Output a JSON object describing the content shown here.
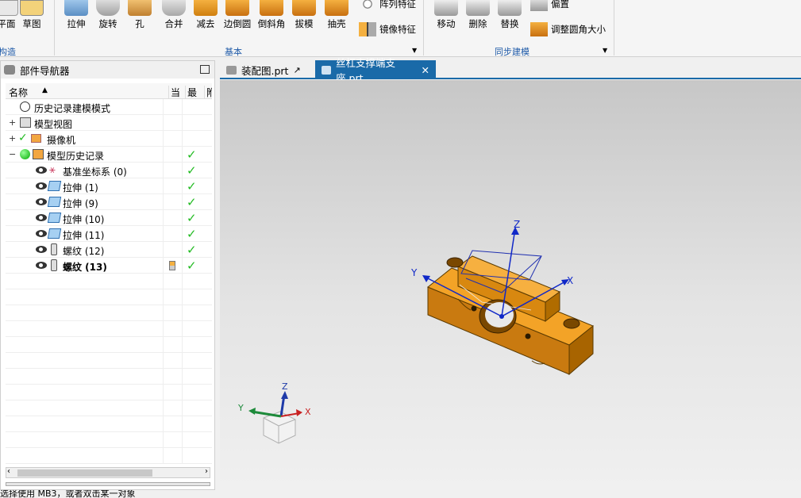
{
  "ribbon": {
    "left_group": {
      "buttons": [
        "平面",
        "草图"
      ],
      "label": "构造"
    },
    "basic_group": {
      "buttons": [
        "拉伸",
        "旋转",
        "孔",
        "合并",
        "减去",
        "边倒圆",
        "倒斜角",
        "拔模",
        "抽壳"
      ],
      "small_buttons": [
        "阵列特征",
        "镜像特征"
      ],
      "label": "基本"
    },
    "sync_group": {
      "buttons": [
        "移动",
        "删除",
        "替换"
      ],
      "small_buttons": [
        "偏置",
        "调整圆角大小"
      ],
      "label": "同步建模"
    }
  },
  "navigator": {
    "title": "部件导航器",
    "columns": {
      "name": "名称",
      "current": "当",
      "latest": "最",
      "attach": "附"
    },
    "rows": [
      {
        "label": "历史记录建模模式",
        "kind": "clock"
      },
      {
        "label": "模型视图",
        "kind": "view"
      },
      {
        "label": "摄像机",
        "kind": "camera"
      },
      {
        "label": "模型历史记录",
        "kind": "history"
      },
      {
        "label": "基准坐标系 (0)",
        "kind": "datum"
      },
      {
        "label": "拉伸 (1)",
        "kind": "extrude"
      },
      {
        "label": "拉伸 (9)",
        "kind": "extrude"
      },
      {
        "label": "拉伸 (10)",
        "kind": "extrude"
      },
      {
        "label": "拉伸 (11)",
        "kind": "extrude"
      },
      {
        "label": "螺纹 (12)",
        "kind": "thread"
      },
      {
        "label": "螺纹 (13)",
        "kind": "thread",
        "bold": true
      }
    ]
  },
  "tabs": [
    {
      "label": "装配图.prt",
      "active": false
    },
    {
      "label": "丝杠支撑端支座.prt",
      "active": true
    }
  ],
  "viewport": {
    "axis_labels": {
      "z": "Z",
      "y": "Y",
      "x": "X"
    },
    "part_color": "#ee9a16"
  },
  "status": {
    "text": "选择使用 MB3，或者双击某一对象"
  },
  "colors": {
    "accent": "#1a6aa8",
    "check": "#22bb22",
    "group_label": "#1f5aa8"
  }
}
